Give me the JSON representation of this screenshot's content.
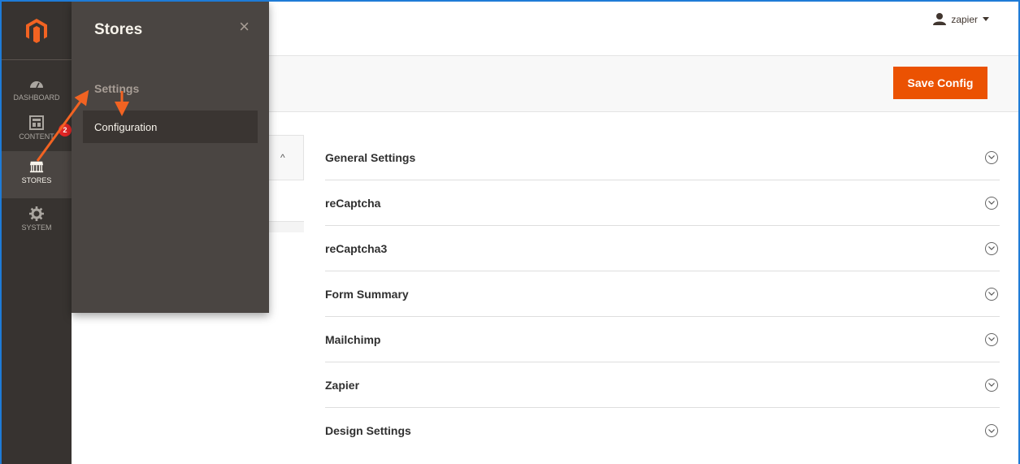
{
  "nav": {
    "items": [
      {
        "label": "DASHBOARD",
        "icon": "dashboard-icon"
      },
      {
        "label": "CONTENT",
        "icon": "content-icon"
      },
      {
        "label": "STORES",
        "icon": "stores-icon"
      },
      {
        "label": "SYSTEM",
        "icon": "gear-icon"
      }
    ],
    "badge": "2"
  },
  "header": {
    "user": "zapier",
    "save_label": "Save Config"
  },
  "flyout": {
    "title": "Stores",
    "close": "×",
    "group_label": "Settings",
    "item_label": "Configuration"
  },
  "left_tabs": {
    "chevron": "^"
  },
  "sections": [
    {
      "title": "General Settings"
    },
    {
      "title": "reCaptcha"
    },
    {
      "title": "reCaptcha3"
    },
    {
      "title": "Form Summary"
    },
    {
      "title": "Mailchimp"
    },
    {
      "title": "Zapier"
    },
    {
      "title": "Design Settings"
    }
  ],
  "colors": {
    "accent": "#eb5202",
    "nav_bg": "#373330",
    "flyout_bg": "#4a4542",
    "arrow": "#f26322"
  }
}
